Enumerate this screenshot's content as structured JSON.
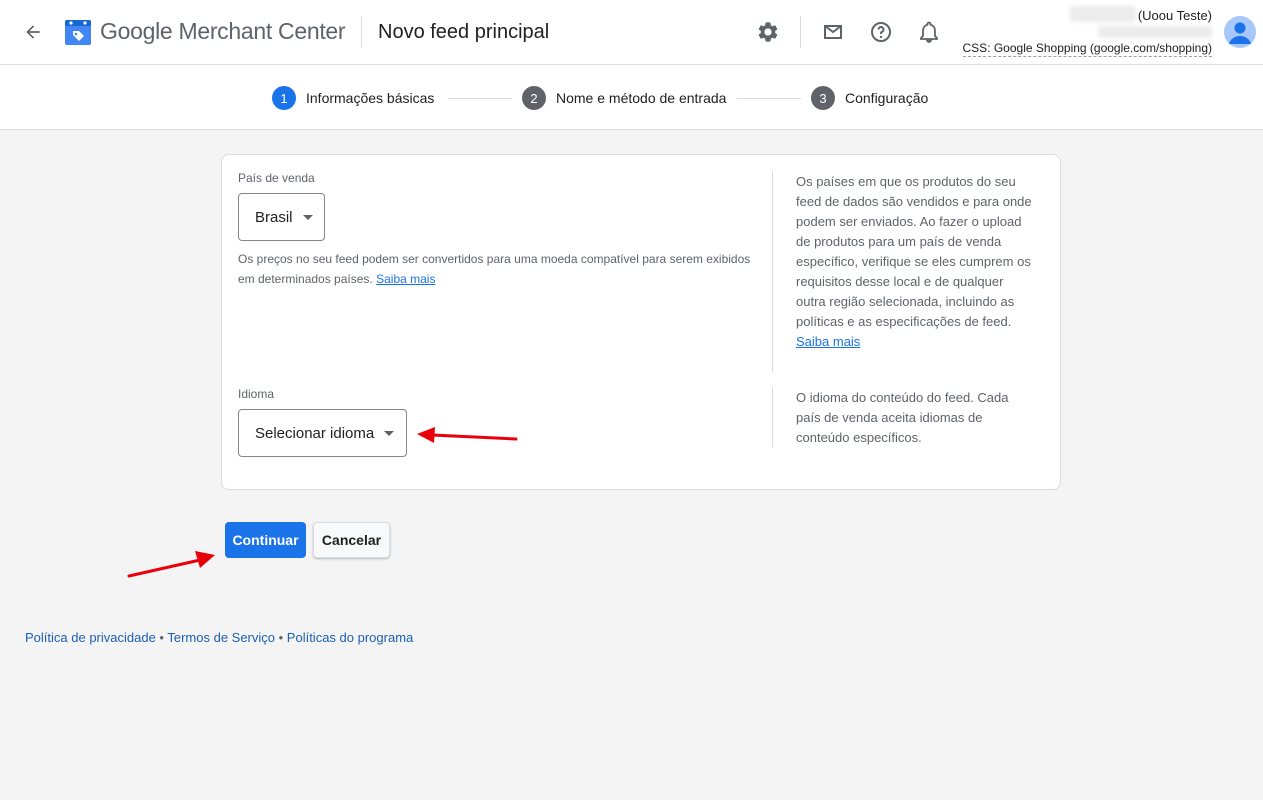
{
  "header": {
    "back_icon": "arrow-back-icon",
    "logo_icon": "merchant-center-logo",
    "brand_google": "Google",
    "brand_product": "Merchant Center",
    "page_title": "Novo feed principal",
    "icons": [
      "settings-icon",
      "mail-icon",
      "help-icon",
      "notifications-icon"
    ],
    "account_name": "(Uoou Teste)",
    "account_css": "CSS: Google Shopping (google.com/shopping)",
    "avatar_icon": "person-avatar"
  },
  "stepper": {
    "steps": [
      {
        "number": "1",
        "label": "Informações básicas",
        "state": "active"
      },
      {
        "number": "2",
        "label": "Nome e método de entrada",
        "state": "inactive"
      },
      {
        "number": "3",
        "label": "Configuração",
        "state": "inactive"
      }
    ]
  },
  "form": {
    "country": {
      "label": "País de venda",
      "value": "Brasil",
      "hint": "Os preços no seu feed podem ser convertidos para uma moeda compatível para serem exibidos em determinados países.",
      "hint_link": "Saiba mais",
      "help": "Os países em que os produtos do seu feed de dados são vendidos e para onde podem ser enviados. Ao fazer o upload de produtos para um país de venda específico, verifique se eles cumprem os requisitos desse local e de qualquer outra região selecionada, incluindo as políticas e as especificações de feed.",
      "help_link": "Saiba mais"
    },
    "language": {
      "label": "Idioma",
      "value": "Selecionar idioma",
      "help": "O idioma do conteúdo do feed. Cada país de venda aceita idiomas de conteúdo específicos."
    }
  },
  "actions": {
    "continue_label": "Continuar",
    "cancel_label": "Cancelar"
  },
  "footer": {
    "links": [
      "Política de privacidade",
      "Termos de Serviço",
      "Políticas do programa"
    ],
    "separator": " • "
  },
  "colors": {
    "accent": "#1a73e8",
    "annotation_arrow": "#e8000b"
  }
}
